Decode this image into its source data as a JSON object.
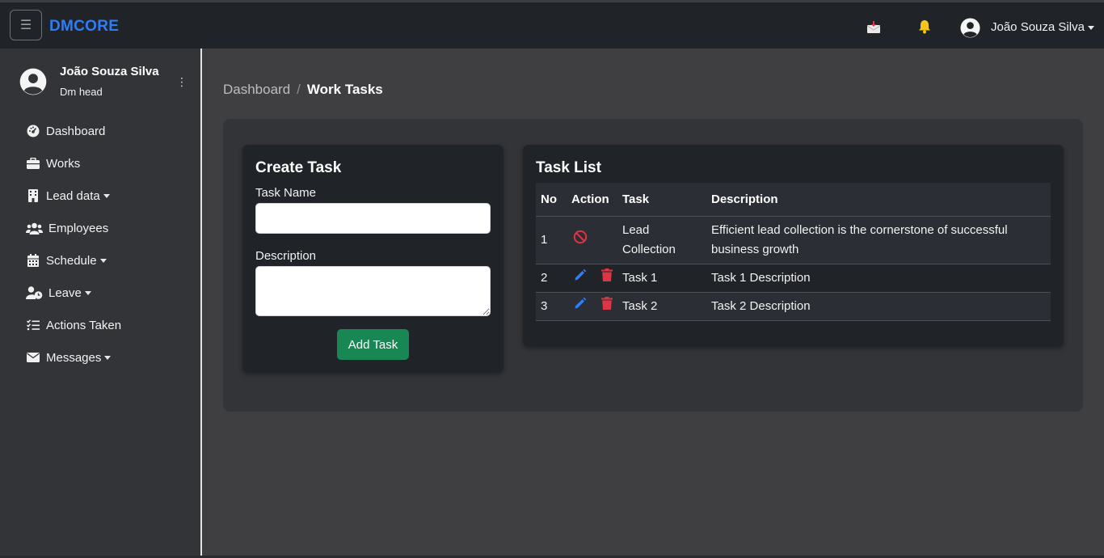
{
  "app": {
    "brand": "DMCORE",
    "menu_icon": "hamburger-icon",
    "user_name": "João Souza Silva"
  },
  "sidebar": {
    "name": "João Souza Silva",
    "role": "Dm head",
    "items": [
      {
        "label": "Dashboard",
        "icon": "dashboard-icon",
        "dropdown": false
      },
      {
        "label": "Works",
        "icon": "briefcase-icon",
        "dropdown": false
      },
      {
        "label": "Lead data",
        "icon": "building-icon",
        "dropdown": true
      },
      {
        "label": "Employees",
        "icon": "users-icon",
        "dropdown": false
      },
      {
        "label": "Schedule",
        "icon": "calendar-icon",
        "dropdown": true
      },
      {
        "label": "Leave",
        "icon": "user-clock-icon",
        "dropdown": true
      },
      {
        "label": "Actions Taken",
        "icon": "list-check-icon",
        "dropdown": false
      },
      {
        "label": "Messages",
        "icon": "envelope-icon",
        "dropdown": true
      }
    ]
  },
  "breadcrumb": {
    "parent": "Dashboard",
    "separator": "/",
    "current": "Work Tasks"
  },
  "create_task": {
    "title": "Create Task",
    "task_name_label": "Task Name",
    "task_name_value": "",
    "description_label": "Description",
    "description_value": "",
    "button": "Add Task"
  },
  "task_list": {
    "title": "Task List",
    "columns": [
      "No",
      "Action",
      "Task",
      "Description"
    ],
    "rows": [
      {
        "no": "1",
        "task": "Lead Collection",
        "description": "Efficient lead collection is the cornerstone of successful business growth",
        "actions": [
          "ban-icon"
        ]
      },
      {
        "no": "2",
        "task": "Task 1",
        "description": "Task 1 Description",
        "actions": [
          "edit-icon",
          "delete-icon"
        ]
      },
      {
        "no": "3",
        "task": "Task 2",
        "description": "Task 2 Description",
        "actions": [
          "edit-icon",
          "delete-icon"
        ]
      }
    ]
  },
  "colors": {
    "brand": "#2f7df6",
    "add_button": "#198754",
    "edit_icon": "#2f7df6",
    "delete_icon": "#dc3545",
    "bell_icon": "#f5c518"
  }
}
